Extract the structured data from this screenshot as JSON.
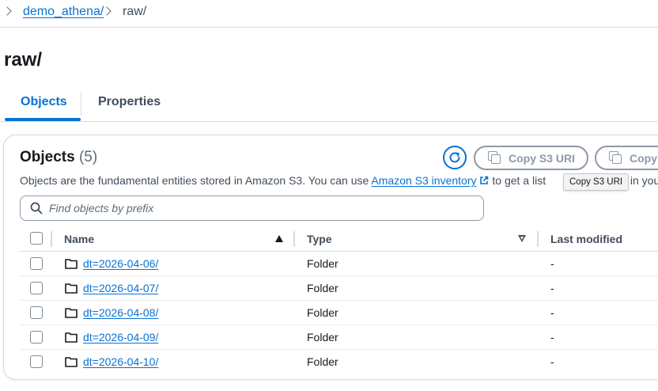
{
  "breadcrumb": {
    "bucket": "demo_athena/",
    "current": "raw/"
  },
  "page": {
    "title": "raw/"
  },
  "tabs": [
    {
      "label": "Objects",
      "active": true
    },
    {
      "label": "Properties",
      "active": false
    }
  ],
  "objects_panel": {
    "title": "Objects",
    "count": "(5)",
    "description_prefix": "Objects are the fundamental entities stored in Amazon S3. You can use ",
    "description_link": "Amazon S3 inventory",
    "description_suffix": " to get a list",
    "description_tail": "s in you",
    "copy_s3_uri_label": "Copy S3 URI",
    "copy_url_label": "Copy",
    "tooltip": "Copy S3 URI",
    "search_placeholder": "Find objects by prefix"
  },
  "table": {
    "columns": [
      "Name",
      "Type",
      "Last modified"
    ],
    "rows": [
      {
        "name": "dt=2026-04-06/",
        "type": "Folder",
        "last_modified": "-"
      },
      {
        "name": "dt=2026-04-07/",
        "type": "Folder",
        "last_modified": "-"
      },
      {
        "name": "dt=2026-04-08/",
        "type": "Folder",
        "last_modified": "-"
      },
      {
        "name": "dt=2026-04-09/",
        "type": "Folder",
        "last_modified": "-"
      },
      {
        "name": "dt=2026-04-10/",
        "type": "Folder",
        "last_modified": "-"
      }
    ]
  },
  "icons": [
    "chevron-right-icon",
    "refresh-icon",
    "copy-icon",
    "external-link-icon",
    "search-icon",
    "sort-ascending-icon",
    "sort-descending-icon",
    "folder-icon"
  ],
  "colors": {
    "accent": "#0972d3",
    "text": "#16191f",
    "secondary": "#414d5c",
    "border": "#d5dbdb",
    "disabled": "#8d99a8"
  }
}
